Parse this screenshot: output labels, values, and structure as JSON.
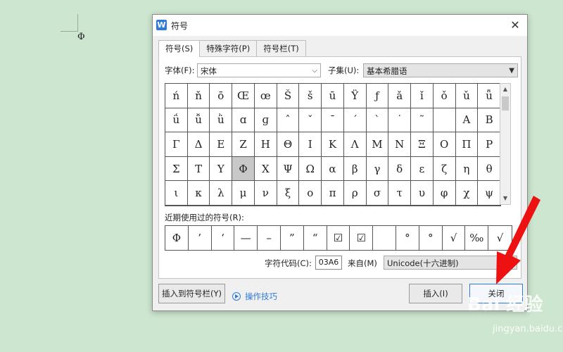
{
  "document": {
    "char": "Φ"
  },
  "dialog": {
    "title": "符号",
    "close_icon": "✕",
    "app_icon_letter": "W",
    "tabs": [
      {
        "label": "符号(S)",
        "active": true
      },
      {
        "label": "特殊字符(P)",
        "active": false
      },
      {
        "label": "符号栏(T)",
        "active": false
      }
    ],
    "font_label": "字体(F):",
    "font_value": "宋体",
    "subset_label": "子集(U):",
    "subset_value": "基本希腊语",
    "grid_rows": [
      [
        "ń",
        "ň",
        "ō",
        "Œ",
        "œ",
        "Š",
        "š",
        "ū",
        "Ÿ",
        "ƒ",
        "ǎ",
        "ǐ",
        "ǒ",
        "ǔ",
        "ǖ"
      ],
      [
        "ǘ",
        "ǚ",
        "ǜ",
        "ɑ",
        "ɡ",
        "ˆ",
        "ˇ",
        "ˉ",
        "ˊ",
        "ˋ",
        "˙",
        "˜",
        "",
        "Α",
        "Β"
      ],
      [
        "Γ",
        "Δ",
        "Ε",
        "Ζ",
        "Η",
        "Θ",
        "Ι",
        "Κ",
        "Λ",
        "Μ",
        "Ν",
        "Ξ",
        "Ο",
        "Π",
        "Ρ"
      ],
      [
        "Σ",
        "Τ",
        "Υ",
        "Φ",
        "Χ",
        "Ψ",
        "Ω",
        "α",
        "β",
        "γ",
        "δ",
        "ε",
        "ζ",
        "η",
        "θ"
      ],
      [
        "ι",
        "κ",
        "λ",
        "μ",
        "ν",
        "ξ",
        "ο",
        "π",
        "ρ",
        "σ",
        "τ",
        "υ",
        "φ",
        "χ",
        "ψ"
      ]
    ],
    "selected": {
      "row": 3,
      "col": 3
    },
    "recent_label": "近期使用过的符号(R):",
    "recent": [
      "Φ",
      "’",
      "‘",
      "—",
      "–",
      "”",
      "“",
      "☑",
      "☑",
      "",
      "°",
      "°",
      "√",
      "‰",
      "√"
    ],
    "code_label": "字符代码(C):",
    "code_value": "03A6",
    "from_label": "来自(M)",
    "from_value": "Unicode(十六进制)",
    "insert_to_bar_button": "插入到符号栏(Y)",
    "tips_link": "操作技巧",
    "insert_button": "插入(I)",
    "close_button": "关闭"
  },
  "annotation": {
    "arrow_color": "#ee1111"
  },
  "watermark": {
    "brand": "Bai 经验",
    "url": "jingyan.baidu.com"
  }
}
